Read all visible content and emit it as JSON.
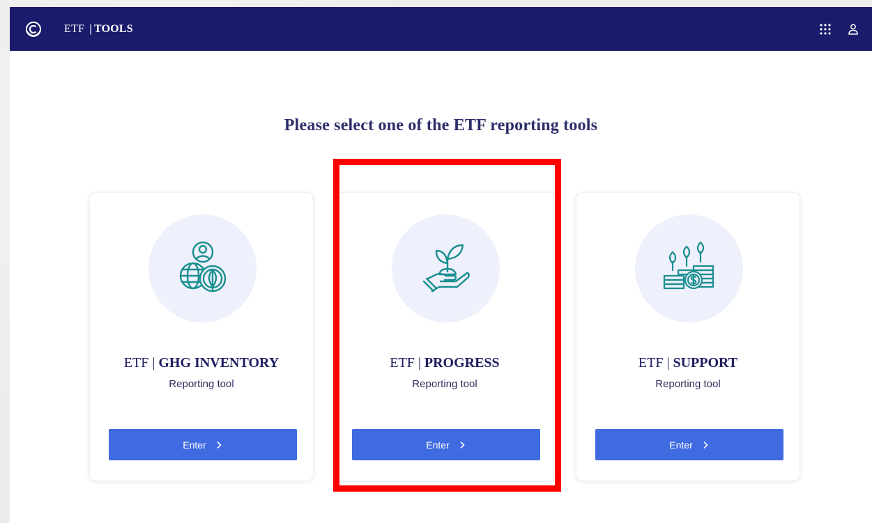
{
  "header": {
    "brand_prefix": "ETF",
    "brand_separator": "|",
    "brand_name": "TOOLS",
    "logo_icon": "un-emblem-icon",
    "apps_icon": "apps-grid-icon",
    "user_icon": "user-icon"
  },
  "page": {
    "title": "Please select one of the ETF reporting tools"
  },
  "cards": [
    {
      "prefix": "ETF",
      "separator": "|",
      "name": "GHG INVENTORY",
      "subtitle": "Reporting tool",
      "button_label": "Enter",
      "icon": "people-globe-leaf-icon"
    },
    {
      "prefix": "ETF",
      "separator": "|",
      "name": "PROGRESS",
      "subtitle": "Reporting tool",
      "button_label": "Enter",
      "icon": "hand-sprout-icon"
    },
    {
      "prefix": "ETF",
      "separator": "|",
      "name": "SUPPORT",
      "subtitle": "Reporting tool",
      "button_label": "Enter",
      "icon": "money-plants-icon"
    }
  ],
  "colors": {
    "header_bg": "#1a1b6b",
    "accent_button": "#3f6ae0",
    "icon_teal": "#1a8f8f",
    "highlight": "#ff0000",
    "circle_bg": "#eef0fb"
  }
}
